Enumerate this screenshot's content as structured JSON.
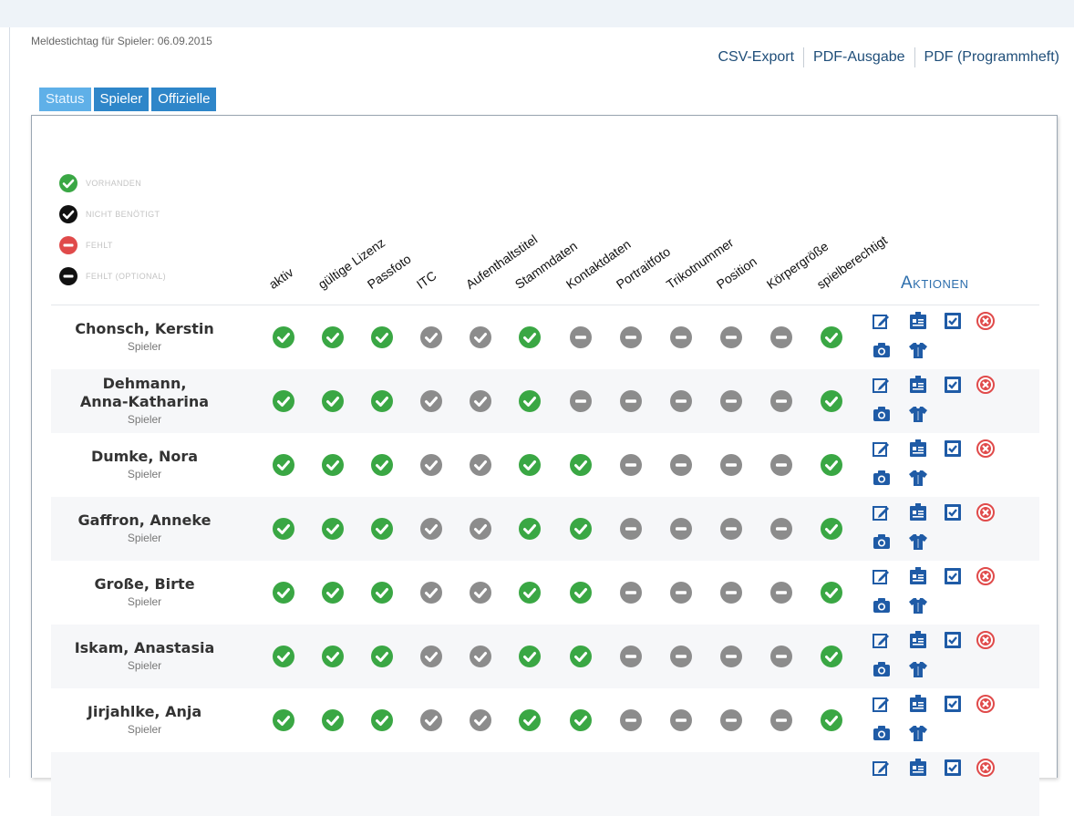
{
  "header": {
    "meldedate": "Meldestichtag für Spieler: 06.09.2015",
    "exports": [
      "CSV-Export",
      "PDF-Ausgabe",
      "PDF (Programmheft)"
    ]
  },
  "tabs": [
    "Status",
    "Spieler",
    "Offizielle"
  ],
  "active_tab": "Status",
  "legend": [
    {
      "label": "Vorhanden",
      "icon": "check-green"
    },
    {
      "label": "Nicht benötigt",
      "icon": "check-black"
    },
    {
      "label": "Fehlt",
      "icon": "minus-red"
    },
    {
      "label": "Fehlt (optional)",
      "icon": "minus-black"
    }
  ],
  "columns": [
    "aktiv",
    "gültige Lizenz",
    "Passfoto",
    "ITC",
    "Aufenthaltstitel",
    "Stammdaten",
    "Kontaktdaten",
    "Portraitfoto",
    "Trikotnummer",
    "Position",
    "Körpergröße",
    "spielberechtigt"
  ],
  "actions_header": "Aktionen",
  "action_icons": [
    "edit-icon",
    "id-card-icon",
    "checkbox-icon",
    "remove-icon",
    "camera-icon",
    "jersey-icon"
  ],
  "colors": {
    "green": "#3aa744",
    "gray": "#8c8c8c",
    "red": "#e04a4a",
    "blue": "#1f5ba6",
    "link": "#1f4e79"
  },
  "rows": [
    {
      "name": "Chonsch, Kerstin",
      "role": "Spieler",
      "status": [
        "G",
        "G",
        "G",
        "C",
        "C",
        "G",
        "M",
        "M",
        "M",
        "M",
        "M",
        "G"
      ]
    },
    {
      "name": "Dehmann,\nAnna-Katharina",
      "role": "Spieler",
      "status": [
        "G",
        "G",
        "G",
        "C",
        "C",
        "G",
        "M",
        "M",
        "M",
        "M",
        "M",
        "G"
      ]
    },
    {
      "name": "Dumke, Nora",
      "role": "Spieler",
      "status": [
        "G",
        "G",
        "G",
        "C",
        "C",
        "G",
        "G",
        "M",
        "M",
        "M",
        "M",
        "G"
      ]
    },
    {
      "name": "Gaffron, Anneke",
      "role": "Spieler",
      "status": [
        "G",
        "G",
        "G",
        "C",
        "C",
        "G",
        "G",
        "M",
        "M",
        "M",
        "M",
        "G"
      ]
    },
    {
      "name": "Große, Birte",
      "role": "Spieler",
      "status": [
        "G",
        "G",
        "G",
        "C",
        "C",
        "G",
        "G",
        "M",
        "M",
        "M",
        "M",
        "G"
      ]
    },
    {
      "name": "Iskam, Anastasia",
      "role": "Spieler",
      "status": [
        "G",
        "G",
        "G",
        "C",
        "C",
        "G",
        "G",
        "M",
        "M",
        "M",
        "M",
        "G"
      ]
    },
    {
      "name": "Jirjahlke, Anja",
      "role": "Spieler",
      "status": [
        "G",
        "G",
        "G",
        "C",
        "C",
        "G",
        "G",
        "M",
        "M",
        "M",
        "M",
        "G"
      ]
    }
  ]
}
